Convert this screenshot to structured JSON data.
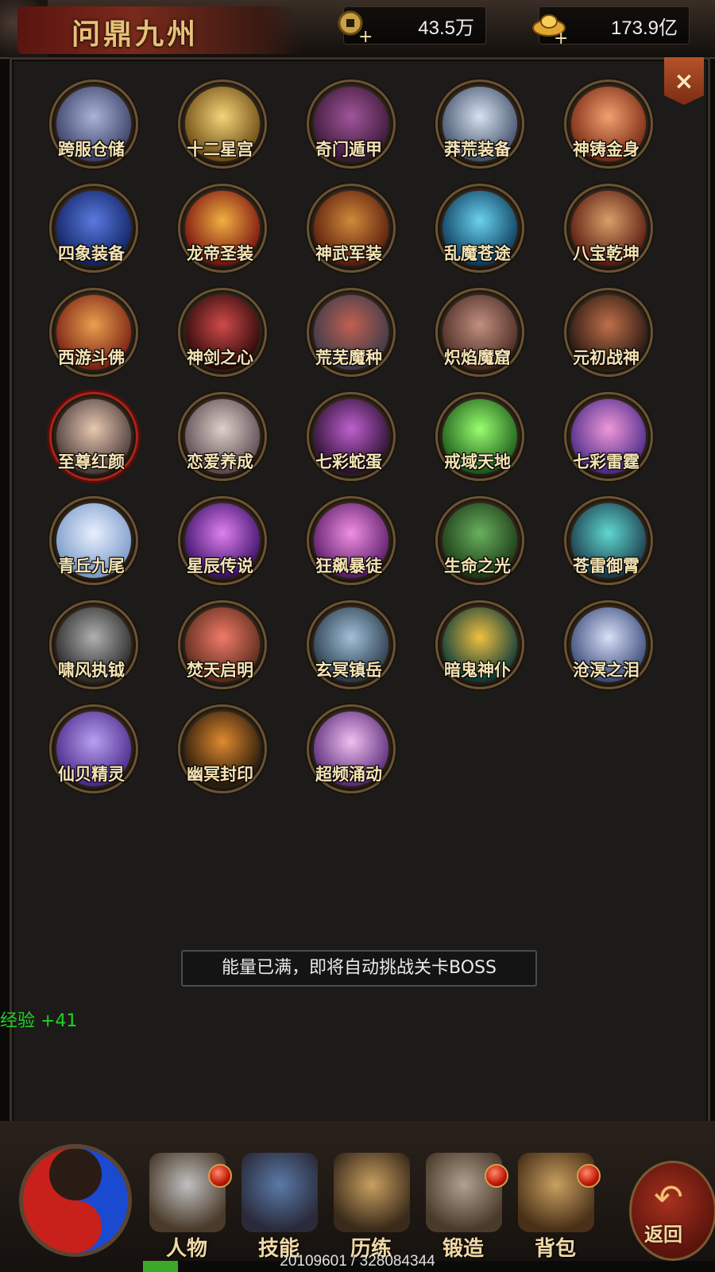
{
  "header": {
    "title": "问鼎九州",
    "currency_coin": {
      "icon": "coin-plus-icon",
      "value": "43.5万"
    },
    "currency_ingot": {
      "icon": "gold-ingot-plus-icon",
      "value": "173.9亿"
    },
    "close_icon": "close-icon",
    "close_glyph": "×"
  },
  "features": [
    {
      "label": "跨服仓储",
      "colors": [
        "#a9b4d8",
        "#3a3f66"
      ]
    },
    {
      "label": "十二星宫",
      "colors": [
        "#f3d57a",
        "#6d4a12"
      ]
    },
    {
      "label": "奇门遁甲",
      "colors": [
        "#a0569a",
        "#3c1838"
      ]
    },
    {
      "label": "莽荒装备",
      "colors": [
        "#d7e2f0",
        "#41506a"
      ]
    },
    {
      "label": "神铸金身",
      "colors": [
        "#f0a070",
        "#7a2a12"
      ]
    },
    {
      "label": "四象装备",
      "colors": [
        "#5a7ae0",
        "#102262"
      ]
    },
    {
      "label": "龙帝圣装",
      "colors": [
        "#f0b040",
        "#7a1010"
      ]
    },
    {
      "label": "神武军装",
      "colors": [
        "#d08a3a",
        "#5a1c0c"
      ]
    },
    {
      "label": "乱魔苍途",
      "colors": [
        "#6ad2f0",
        "#0c3a5a"
      ]
    },
    {
      "label": "八宝乾坤",
      "colors": [
        "#d8a06a",
        "#5a1a10"
      ]
    },
    {
      "label": "西游斗佛",
      "colors": [
        "#e8a050",
        "#7a2012"
      ]
    },
    {
      "label": "神剑之心",
      "colors": [
        "#d04a4a",
        "#2a0808"
      ]
    },
    {
      "label": "荒芜魔种",
      "colors": [
        "#c06050",
        "#3a3a4a"
      ]
    },
    {
      "label": "炽焰魔窟",
      "colors": [
        "#c09080",
        "#4a2a24"
      ]
    },
    {
      "label": "元初战神",
      "colors": [
        "#c0704a",
        "#2a1812"
      ]
    },
    {
      "label": "至尊红颜",
      "colors": [
        "#e8c8b0",
        "#4a3a3a"
      ]
    },
    {
      "label": "恋爱养成",
      "colors": [
        "#e0d0c8",
        "#5a4a52"
      ]
    },
    {
      "label": "七彩蛇蛋",
      "colors": [
        "#c060d0",
        "#2a1030"
      ]
    },
    {
      "label": "戒域天地",
      "colors": [
        "#9aff70",
        "#1a5a1a"
      ]
    },
    {
      "label": "七彩雷霆",
      "colors": [
        "#f098d8",
        "#4a2a8a"
      ]
    },
    {
      "label": "青丘九尾",
      "colors": [
        "#e8f0ff",
        "#7a9ac8"
      ]
    },
    {
      "label": "星辰传说",
      "colors": [
        "#e080f0",
        "#3a1068"
      ]
    },
    {
      "label": "狂飙暴徒",
      "colors": [
        "#f090e0",
        "#5a1a6a"
      ]
    },
    {
      "label": "生命之光",
      "colors": [
        "#6ab060",
        "#1a3a14"
      ]
    },
    {
      "label": "苍雷御霄",
      "colors": [
        "#60d8d0",
        "#1a3a4a"
      ]
    },
    {
      "label": "啸风执钺",
      "colors": [
        "#b0b0b0",
        "#2a2a2a"
      ]
    },
    {
      "label": "焚天启明",
      "colors": [
        "#f07a6a",
        "#5a2a1a"
      ]
    },
    {
      "label": "玄冥镇岳",
      "colors": [
        "#a0c0d8",
        "#2a3a4a"
      ]
    },
    {
      "label": "暗鬼神仆",
      "colors": [
        "#f0c040",
        "#0a3a3a"
      ]
    },
    {
      "label": "沧溟之泪",
      "colors": [
        "#d8e0f8",
        "#3a4a7a"
      ]
    },
    {
      "label": "仙贝精灵",
      "colors": [
        "#b8a0f0",
        "#4a2a8a"
      ]
    },
    {
      "label": "幽冥封印",
      "colors": [
        "#e08a30",
        "#2a1a0a"
      ]
    },
    {
      "label": "超频涌动",
      "colors": [
        "#f0c0f0",
        "#5a2a7a"
      ]
    }
  ],
  "toast": "能量已满，即将自动挑战关卡BOSS",
  "exp_gain": "经验 +41",
  "bottom_nav": [
    {
      "label": "人物",
      "icon": "helmet-icon",
      "badge": true
    },
    {
      "label": "技能",
      "icon": "skill-book-icon",
      "badge": false
    },
    {
      "label": "历练",
      "icon": "armor-icon",
      "badge": false
    },
    {
      "label": "锻造",
      "icon": "anvil-icon",
      "badge": true
    },
    {
      "label": "背包",
      "icon": "backpack-icon",
      "badge": true
    }
  ],
  "back_button": {
    "label": "返回",
    "icon": "back-arrow-icon"
  },
  "experience": {
    "text": "20109601 / 328084344",
    "fraction": 0.0613
  }
}
